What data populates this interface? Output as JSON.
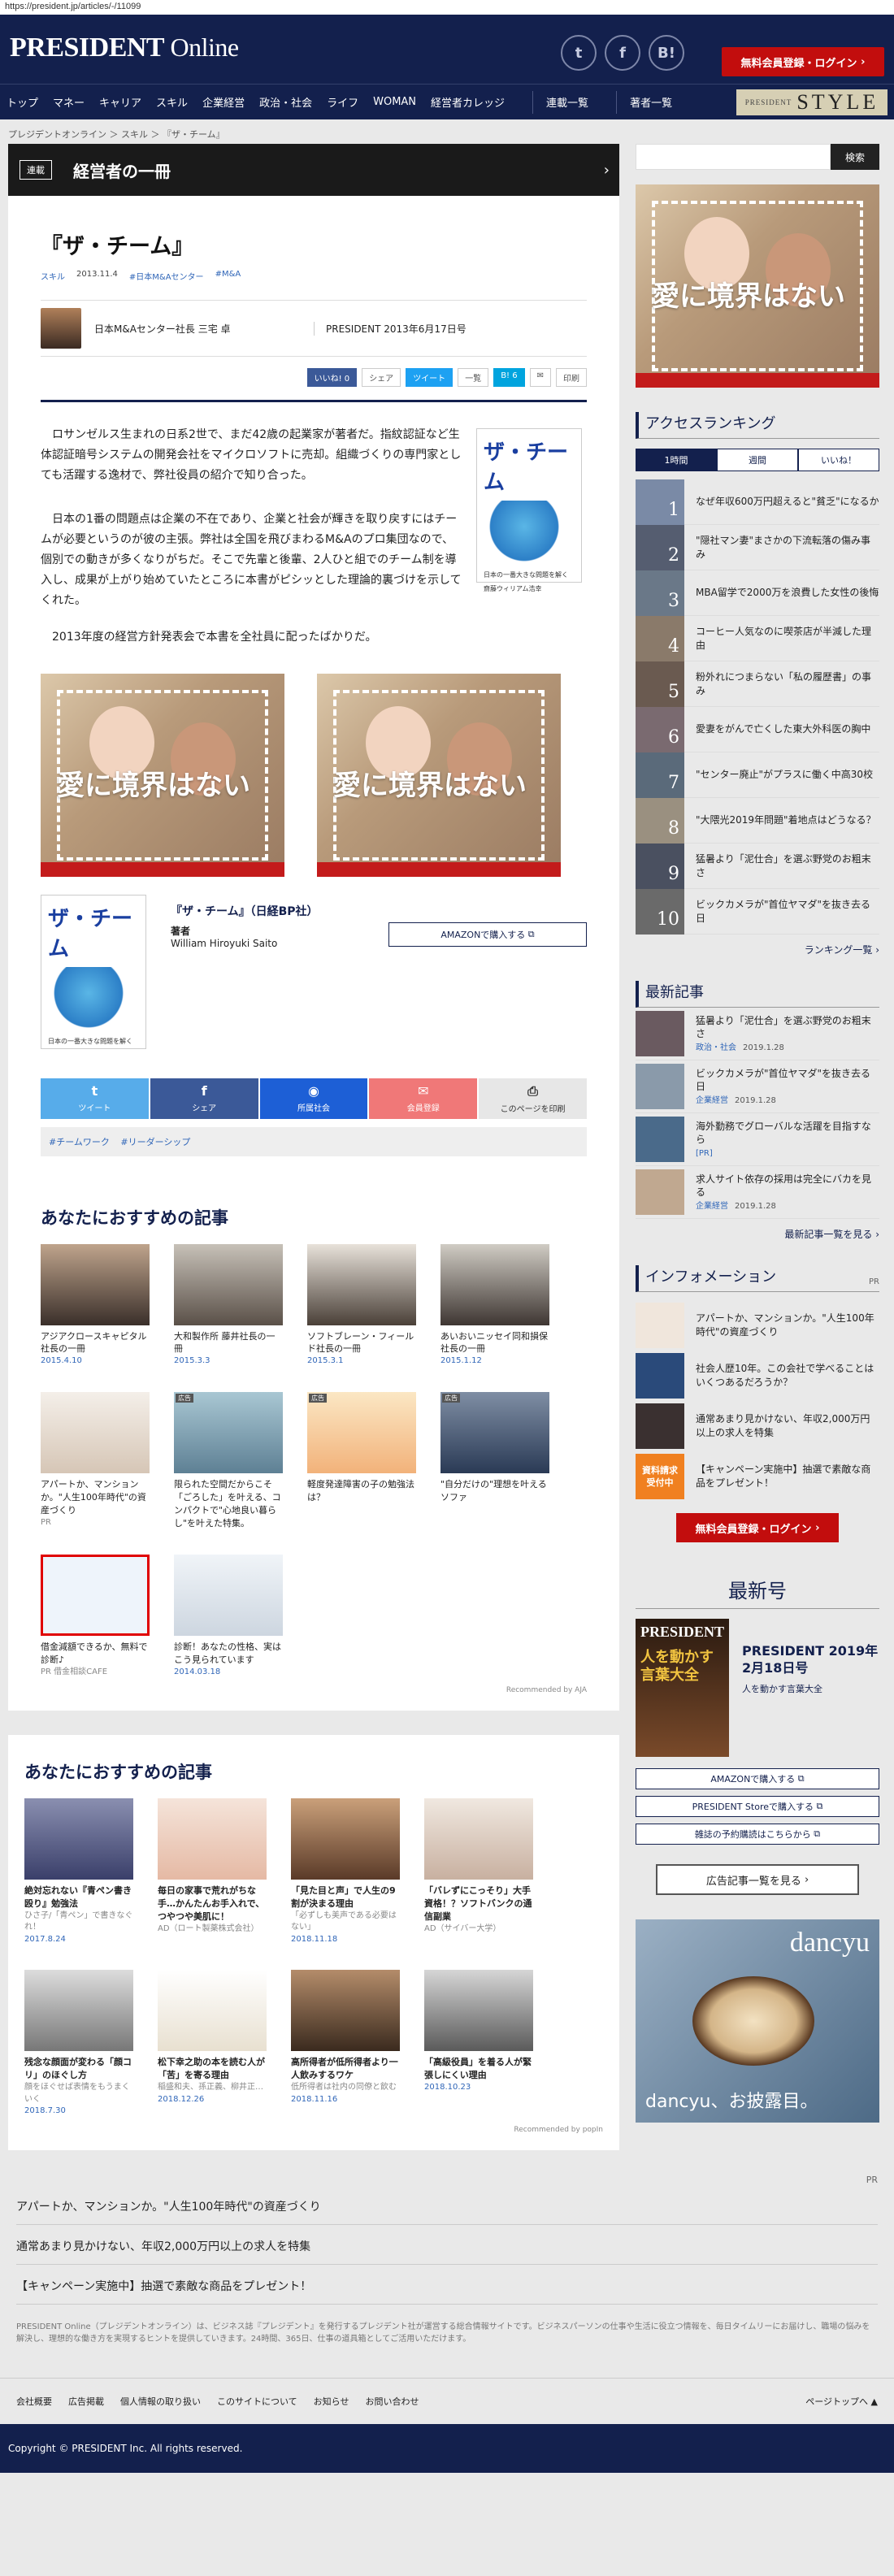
{
  "url": "https://president.jp/articles/-/11099",
  "header": {
    "logo_main": "PRESIDENT",
    "logo_sub": "Online",
    "social": [
      "twitter-icon",
      "facebook-icon",
      "hatena-icon"
    ],
    "social_glyphs": [
      "t",
      "f",
      "B!"
    ],
    "signup": "無料会員登録・ログイン"
  },
  "nav": {
    "items": [
      "トップ",
      "マネー",
      "キャリア",
      "スキル",
      "企業経営",
      "政治・社会",
      "ライフ",
      "WOMAN",
      "経営者カレッジ"
    ],
    "series": "連載一覧",
    "writers": "著者一覧",
    "style_small": "PRESIDENT",
    "style_big": "STYLE"
  },
  "breadcrumb": "プレジデントオンライン ＞ スキル ＞ 『ザ・チーム』",
  "series_bar": {
    "tag": "連載",
    "title": "経営者の一冊"
  },
  "article": {
    "title": "『ザ・チーム』",
    "category": "スキル",
    "date": "2013.11.4",
    "tag1": "#日本M&Aセンター",
    "tag2": "#M&A",
    "author": "日本M&Aセンター社長 三宅 卓",
    "publication": "PRESIDENT 2013年6月17日号",
    "share_like": "いいね! 0",
    "share_fb": "シェア",
    "share_tw": "ツイート",
    "share_list": "一覧",
    "share_hb": "B! 6",
    "share_print": "印刷",
    "p1": "ロサンゼルス生まれの日系2世で、まだ42歳の起業家が著者だ。指紋認証など生体認証暗号システムの開発会社をマイクロソフトに売却。組織づくりの専門家としても活躍する逸材で、弊社役員の紹介で知り合った。",
    "p2": "日本の1番の問題点は企業の不在であり、企業と社会が輝きを取り戻すにはチームが必要というのが彼の主張。弊社は全国を飛びまわるM&Aのプロ集団なので、個別での動きが多くなりがちだ。そこで先輩と後輩、2人ひと組でのチーム制を導入し、成果が上がり始めていたところに本書がピシッとした理論的裏づけを示してくれた。",
    "p3": "2013年度の経営方針発表会で本書を全社員に配ったばかりだ。",
    "book_cover_title": "ザ・チーム",
    "book_cover_sub": "日本の一番大きな問題を解く",
    "book_cover_author": "齋藤ウィリアム浩幸",
    "ad_text": "愛に境界はない"
  },
  "book": {
    "title": "『ザ・チーム』（日経BP社）",
    "author_label": "著者",
    "author": "William Hiroyuki Saito",
    "amazon": "AMAZONで購入する"
  },
  "share_big": {
    "tw": "ツイート",
    "fb": "シェア",
    "ms": "所属社会",
    "ml": "会員登録",
    "pr": "このページを印刷"
  },
  "tags": [
    "#チームワーク",
    "#リーダーシップ"
  ],
  "recommend1": {
    "title": "あなたにおすすめの記事",
    "cards": [
      {
        "title": "アジアクロースキャピタル社長の一冊",
        "date": "2015.4.10"
      },
      {
        "title": "大和製作所 藤井社長の一冊",
        "date": "2015.3.3"
      },
      {
        "title": "ソフトブレーン・フィールド社長の一冊",
        "date": "2015.3.1"
      },
      {
        "title": "あいおいニッセイ同和損保社長の一冊",
        "date": "2015.1.12"
      },
      {
        "title": "アパートか、マンションか。\"人生100年時代\"の資産づくり",
        "date": "PR"
      },
      {
        "title": "限られた空間だからこそ「ごろした」を叶える、コンパクトで\"心地良い暮らし\"を叶えた特集。",
        "date": "広告"
      },
      {
        "title": "軽度発達障害の子の勉強法は？",
        "date": "広告"
      },
      {
        "title": "\"自分だけの\"理想を叶えるソファ",
        "date": "広告"
      },
      {
        "title": "借金減額できるか、無料で診断♪",
        "date": "PR 借金相談CAFE"
      },
      {
        "title": "診断！あなたの性格、実はこう見られています",
        "date": "2014.03.18"
      }
    ],
    "recommended_by": "Recommended by AJA"
  },
  "recommend2": {
    "title": "あなたにおすすめの記事",
    "cards": [
      {
        "title": "絶対忘れない『青ペン書き殴り』勉強法",
        "sub": "ひさ子/「青ペン」で書きなぐれ！",
        "date": "2017.8.24"
      },
      {
        "title": "毎日の家事で荒れがちな手…かんたんお手入れで、つやつや美肌に！",
        "sub": "AD（ロート製薬株式会社）",
        "date": ""
      },
      {
        "title": "「見た目と声」で人生の9割が決まる理由",
        "sub": "「必ずしも美声である必要はない」",
        "date": "2018.11.18"
      },
      {
        "title": "「バレずにこっそり」大手資格！？ソフトバンクの通信副業",
        "sub": "AD（サイバー大学）",
        "date": ""
      },
      {
        "title": "残念な顔面が変わる「顔コリ」のほぐし方",
        "sub": "顔をほぐせば表情をもうまくいく",
        "date": "2018.7.30"
      },
      {
        "title": "松下幸之助の本を読む人が「苦」を寄る理由",
        "sub": "稲盛和夫、孫正義、柳井正…",
        "date": "2018.12.26"
      },
      {
        "title": "高所得者が低所得者より一人飲みするワケ",
        "sub": "低所得者は社内の同僚と飲む",
        "date": "2018.11.16"
      },
      {
        "title": "「高級役員」を着る人が緊張しにくい理由",
        "sub": "",
        "date": "2018.10.23"
      }
    ],
    "recommended_by": "Recommended by popIn"
  },
  "sidebar": {
    "search_btn": "検索",
    "ranking_title": "アクセスランキング",
    "tabs": [
      "1時間",
      "週間",
      "いいね！"
    ],
    "ranking": [
      "なぜ年収600万円超えると\"貧乏\"になるか",
      "\"隠社マン妻\"まさかの下流転落の傷み事み",
      "MBA留学で2000万を浪費した女性の後悔",
      "コーヒー人気なのに喫茶店が半減した理由",
      "粉外れにつまらない「私の履歴書」の事み",
      "愛妻をがんで亡くした東大外科医の胸中",
      "\"センター廃止\"がプラスに働く中高30校",
      "\"大隈光2019年問題\"着地点はどうなる？",
      "猛暑より「泥仕合」を選ぶ野党のお粗末さ",
      "ビックカメラが\"首位ヤマダ\"を抜き去る日"
    ],
    "ranking_more": "ランキング一覧",
    "latest_title": "最新記事",
    "latest": [
      {
        "title": "猛暑より「泥仕合」を選ぶ野党のお粗末さ",
        "cat": "政治・社会",
        "date": "2019.1.28"
      },
      {
        "title": "ビックカメラが\"首位ヤマダ\"を抜き去る日",
        "cat": "企業経営",
        "date": "2019.1.28"
      },
      {
        "title": "海外勤務でグローバルな活躍を目指すなら",
        "cat": "[PR]",
        "date": ""
      },
      {
        "title": "求人サイト依存の採用は完全にバカを見る",
        "cat": "企業経営",
        "date": "2019.1.28"
      }
    ],
    "latest_more": "最新記事一覧を見る",
    "info_title": "インフォメーション",
    "info_pr": "PR",
    "info": [
      "アパートか、マンションか。\"人生100年時代\"の資産づくり",
      "社会人歴10年。この会社で学べることはいくつあるだろうか？",
      "通常あまり見かけない、年収2,000万円以上の求人を特集",
      "【キャンペーン実施中】抽選で素敵な商品をプレゼント！"
    ],
    "info_badge": "資料請求受付中",
    "signup": "無料会員登録・ログイン",
    "issue_title": "最新号",
    "issue_name": "PRESIDENT 2019年2月18日号",
    "issue_sub": "人を動かす言葉大全",
    "mag_title": "人を動かす言葉大全",
    "issue_btns": [
      "AMAZONで購入する",
      "PRESIDENT Storeで購入する",
      "雑誌の予約購読はこちらから"
    ],
    "ad_list": "広告記事一覧を見る",
    "dancyu_logo": "dancyu",
    "dancyu_text": "dancyu、お披露目。"
  },
  "pr_links": {
    "label": "PR",
    "items": [
      "アパートか、マンションか。\"人生100年時代\"の資産づくり",
      "通常あまり見かけない、年収2,000万円以上の求人を特集",
      "【キャンペーン実施中】抽選で素敵な商品をプレゼント！"
    ]
  },
  "footer": {
    "note": "PRESIDENT Online（プレジデントオンライン）は、ビジネス誌『プレジデント』を発行するプレジデント社が運営する総合情報サイトです。ビジネスパーソンの仕事や生活に役立つ情報を、毎日タイムリーにお届けし、職場の悩みを解決し、理想的な働き方を実現するヒントを提供していきます。24時間、365日、仕事の道具箱としてご活用いただけます。",
    "links": [
      "会社概要",
      "広告掲載",
      "個人情報の取り扱い",
      "このサイトについて",
      "お知らせ",
      "お問い合わせ"
    ],
    "top": "ページトップへ",
    "copyright": "Copyright © PRESIDENT Inc. All rights reserved."
  }
}
